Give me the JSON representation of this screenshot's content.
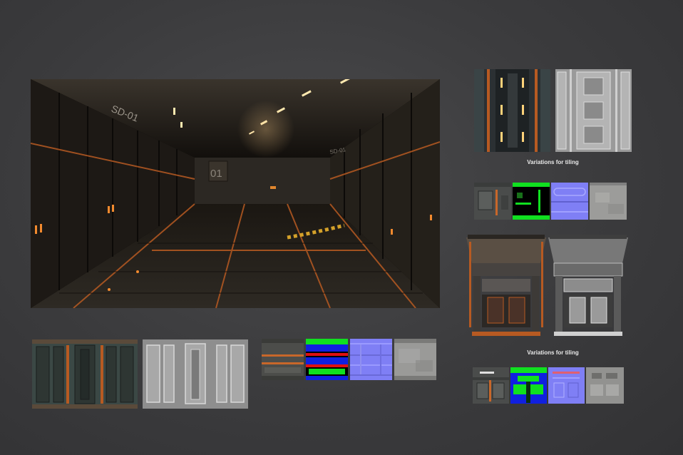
{
  "main_render": {
    "name": "sci-fi corridor render",
    "wall_markings": [
      "SD-01",
      "01",
      "SD-01"
    ]
  },
  "captions": {
    "top_right": "Variations for tiling",
    "middle_right": "Variations for tiling"
  },
  "colors": {
    "background": "#3b3b3d",
    "accent_orange": "#c8672a",
    "normal_map_blue": "#7f7ff5",
    "id_map_green": "#10e020",
    "id_map_blue": "#1020e0",
    "id_map_red": "#e01010",
    "light_glow": "#ffd27a"
  }
}
